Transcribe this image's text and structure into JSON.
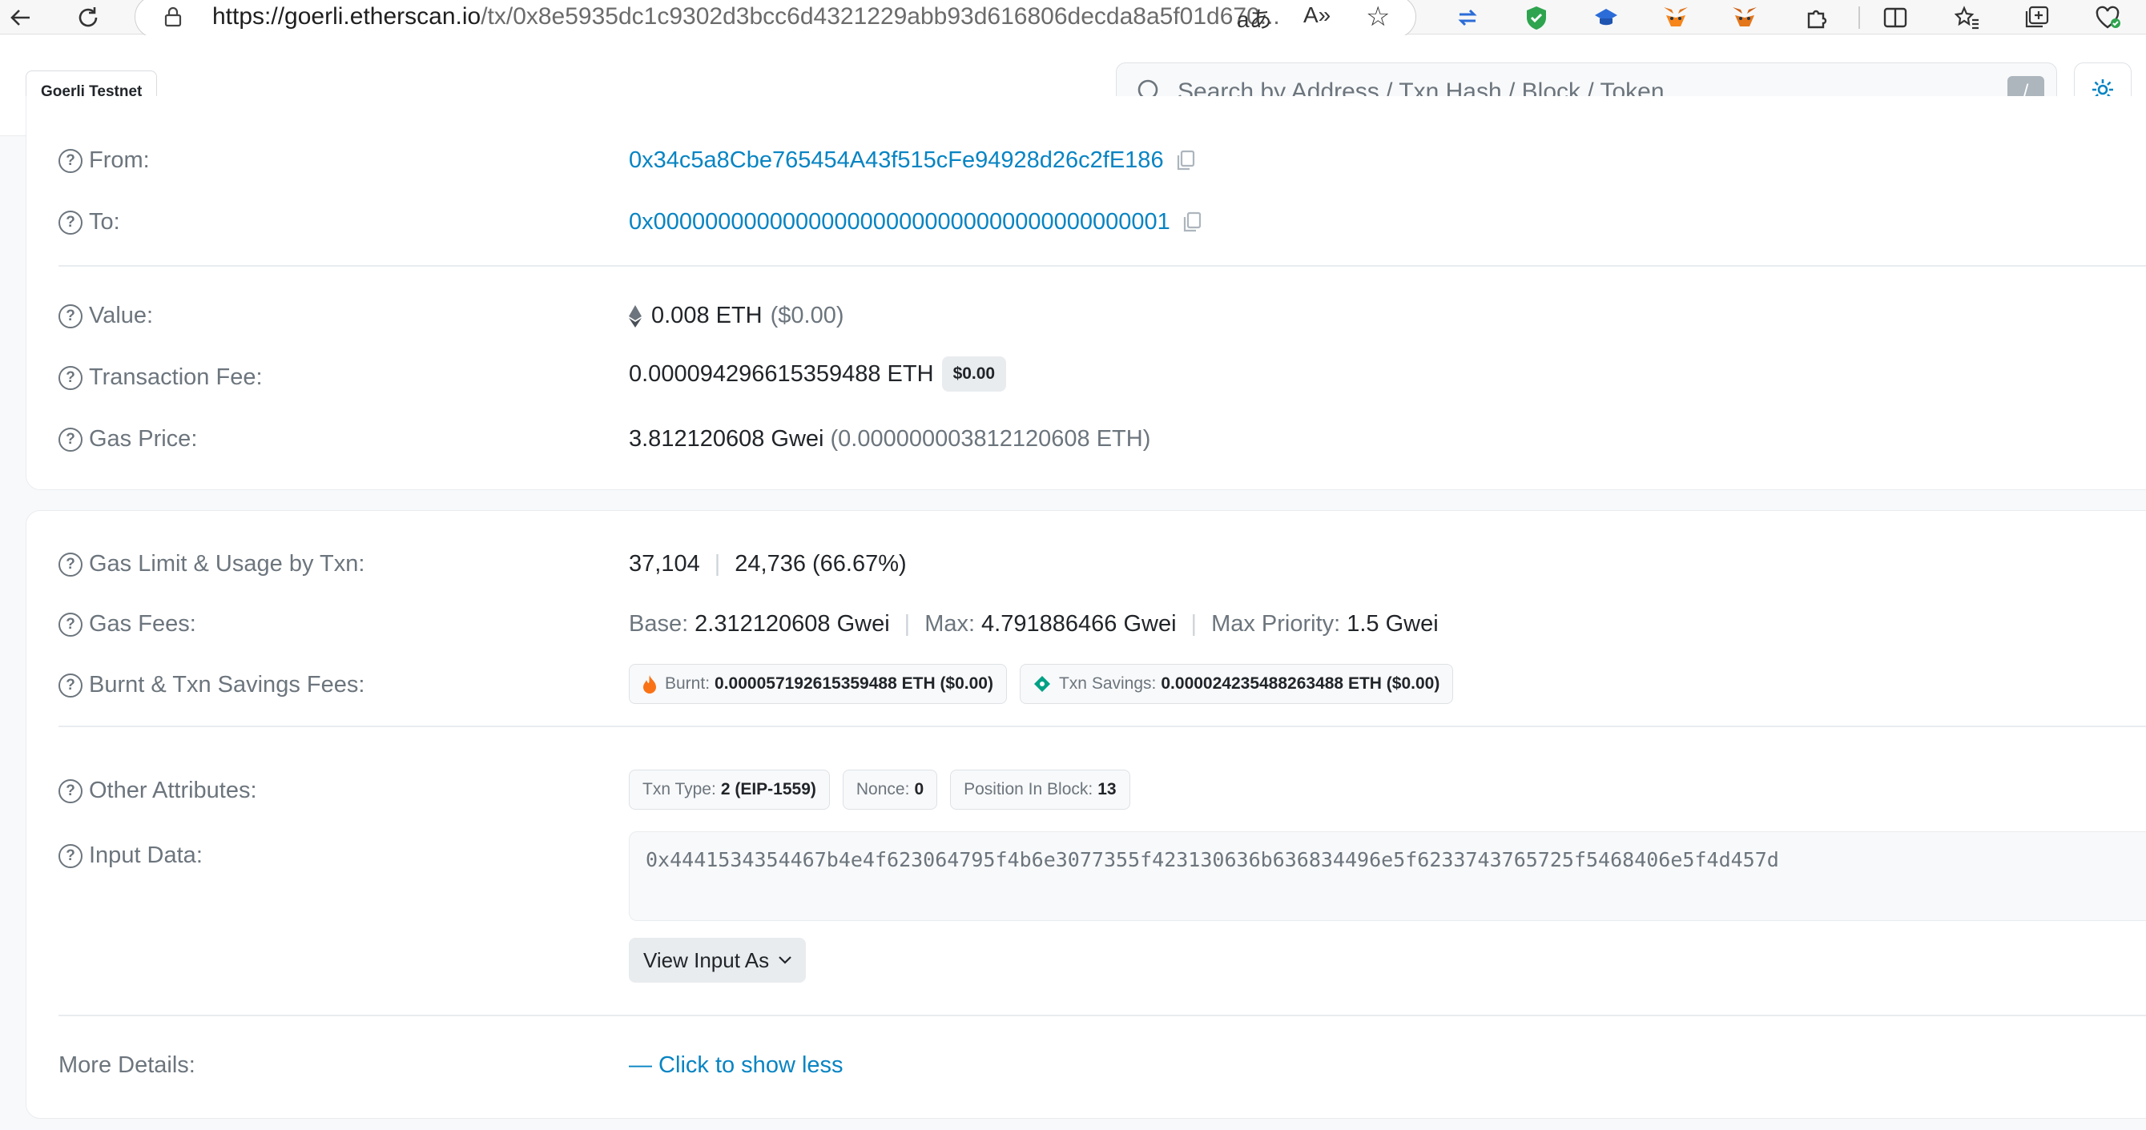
{
  "browser": {
    "url_host": "https://goerli.etherscan.io",
    "url_path": "/tx/0x8e5935dc1c9302d3bcc6d4321229abb93d616806decda8a5f01d670..."
  },
  "header": {
    "network_badge": "Goerli Testnet",
    "search_placeholder": "Search by Address / Txn Hash / Block / Token",
    "search_shortcut": "/"
  },
  "overview": {
    "from_label": "From:",
    "from_value": "0x34c5a8Cbe765454A43f515cFe94928d26c2fE186",
    "to_label": "To:",
    "to_value": "0x0000000000000000000000000000000000000001",
    "value_label": "Value:",
    "value_amount": "0.008 ETH",
    "value_usd": "($0.00)",
    "fee_label": "Transaction Fee:",
    "fee_amount": "0.000094296615359488 ETH",
    "fee_usd": "$0.00",
    "gas_price_label": "Gas Price:",
    "gas_price_gwei": "3.812120608 Gwei",
    "gas_price_eth": "(0.000000003812120608 ETH)"
  },
  "details": {
    "gas_limit_label": "Gas Limit & Usage by Txn:",
    "gas_limit": "37,104",
    "gas_used": "24,736 (66.67%)",
    "gas_fees_label": "Gas Fees:",
    "base_label": "Base:",
    "base_value": "2.312120608 Gwei",
    "max_label": "Max:",
    "max_value": "4.791886466 Gwei",
    "max_priority_label": "Max Priority:",
    "max_priority_value": "1.5 Gwei",
    "burnt_label": "Burnt & Txn Savings Fees:",
    "burnt_chip_label": "Burnt:",
    "burnt_chip_value": "0.000057192615359488 ETH ($0.00)",
    "savings_chip_label": "Txn Savings:",
    "savings_chip_value": "0.000024235488263488 ETH ($0.00)",
    "other_label": "Other Attributes:",
    "txn_type_label": "Txn Type:",
    "txn_type_value": "2 (EIP-1559)",
    "nonce_label": "Nonce:",
    "nonce_value": "0",
    "position_label": "Position In Block:",
    "position_value": "13",
    "input_label": "Input Data:",
    "input_value": "0x4441534354467b4e4f623064795f4b6e3077355f423130636b636834496e5f6233743765725f5468406e5f4d457d",
    "view_input_as": "View Input As",
    "more_label": "More Details:",
    "more_link": "— Click to show less"
  },
  "colors": {
    "link": "#0784c3",
    "muted": "#6c757d",
    "text": "#212529"
  }
}
